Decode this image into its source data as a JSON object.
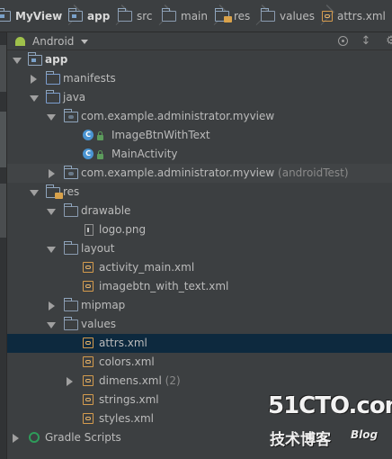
{
  "breadcrumb": {
    "items": [
      {
        "label": "MyView",
        "icon": "module-folder-icon"
      },
      {
        "label": "app",
        "icon": "module-folder-icon"
      },
      {
        "label": "src",
        "icon": "folder-icon"
      },
      {
        "label": "main",
        "icon": "folder-icon"
      },
      {
        "label": "res",
        "icon": "resource-folder-icon"
      },
      {
        "label": "values",
        "icon": "folder-icon"
      },
      {
        "label": "attrs.xml",
        "icon": "xml-file-icon"
      }
    ]
  },
  "project_view": {
    "view_mode": "Android"
  },
  "tree": {
    "app": "app",
    "manifests": "manifests",
    "java": "java",
    "pkg_main": "com.example.administrator.myview",
    "cls_1": "ImageBtnWithText",
    "cls_2": "MainActivity",
    "pkg_test": "com.example.administrator.myview",
    "pkg_test_suffix": "(androidTest)",
    "res": "res",
    "drawable": "drawable",
    "logo": "logo.png",
    "layout": "layout",
    "activity_main": "activity_main.xml",
    "imagebtn": "imagebtn_with_text.xml",
    "mipmap": "mipmap",
    "values": "values",
    "attrs": "attrs.xml",
    "colors": "colors.xml",
    "dimens": "dimens.xml",
    "dimens_count": "(2)",
    "strings": "strings.xml",
    "styles": "styles.xml",
    "gradle": "Gradle Scripts"
  },
  "watermark": {
    "site": "51CTO.com",
    "subtitle": "技术博客",
    "blog": "Blog"
  },
  "colors": {
    "selection": "#0d293e",
    "background": "#3c3f41",
    "class_icon": "#4a95d3",
    "xml_icon": "#d59b4d"
  }
}
